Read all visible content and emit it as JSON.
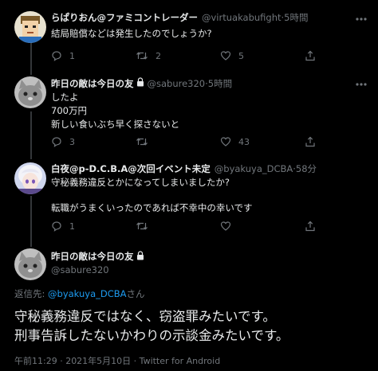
{
  "tweets": [
    {
      "display_name": "らぱりおん@ファミコントレーダー",
      "handle": "@virtuakabufight",
      "time": "5時間",
      "text": "結局賠償などは発生したのでしょうか?",
      "replies": "1",
      "retweets": "2",
      "likes": "5",
      "avatar_icon": "cartoon-face-avatar"
    },
    {
      "display_name": "昨日の敵は今日の友",
      "handle": "@sabure320",
      "time": "5時間",
      "text": "したよ\n700万円\n新しい食いぶち早く探さないと",
      "replies": "3",
      "retweets": "",
      "likes": "43",
      "avatar_icon": "gray-cat-avatar"
    },
    {
      "display_name": "白夜@p-D.C.B.A@次回イベント未定",
      "handle": "@byakuya_DCBA",
      "time": "58分",
      "text": "守秘義務違反とかになってしまいましたか?\n\n転職がうまくいったのであれば不幸中の幸いです",
      "replies": "1",
      "retweets": "",
      "likes": "",
      "avatar_icon": "anime-girl-avatar"
    }
  ],
  "focal": {
    "display_name": "昨日の敵は今日の友",
    "handle": "@sabure320",
    "reply_prefix": "返信先: ",
    "reply_mention": "@byakuya_DCBA",
    "reply_suffix": "さん",
    "text": "守秘義務違反ではなく、窃盗罪みたいです。\n刑事告訴したないかわりの示談金みたいです。",
    "meta": "午前11:29 · 2021年5月10日 · Twitter for Android"
  },
  "separator": " · ",
  "colors": {
    "background": "#000000",
    "text": "#e7e9ea",
    "secondary": "#71767b",
    "accent": "#1d9bf0"
  }
}
